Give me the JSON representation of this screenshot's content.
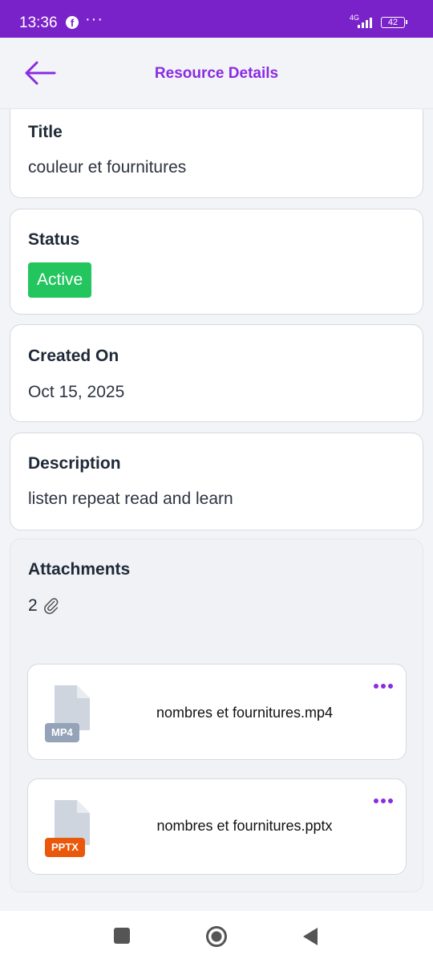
{
  "status_bar": {
    "time": "13:36",
    "dots": "···",
    "network": "4G",
    "battery": "42"
  },
  "header": {
    "title": "Resource Details"
  },
  "details": {
    "title_label": "Title",
    "title_value": "couleur et fournitures",
    "status_label": "Status",
    "status_value": "Active",
    "created_label": "Created On",
    "created_value": "Oct 15, 2025",
    "description_label": "Description",
    "description_value": "listen repeat read and learn"
  },
  "attachments": {
    "label": "Attachments",
    "count": "2",
    "files": [
      {
        "type": "MP4",
        "name": "nombres et fournitures.mp4",
        "tag_color": "#94a3b8"
      },
      {
        "type": "PPTX",
        "name": "nombres et fournitures.pptx",
        "tag_color": "#ea580c"
      }
    ]
  },
  "colors": {
    "accent": "#8a2be2",
    "status_bar": "#7a22c9",
    "active": "#22c55e"
  }
}
